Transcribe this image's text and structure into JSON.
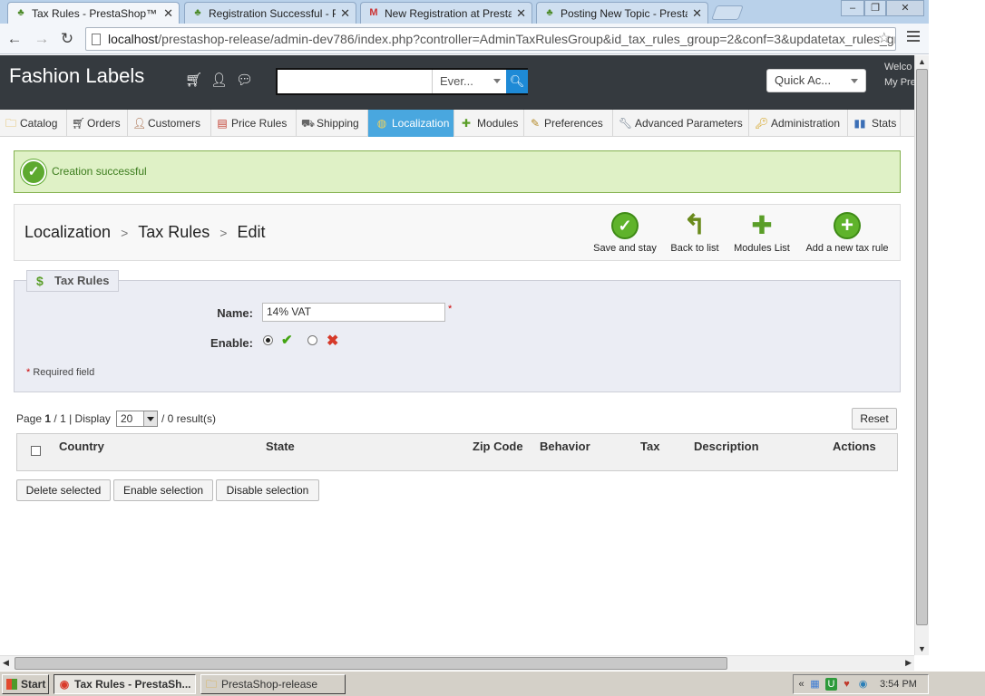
{
  "browser": {
    "tabs": [
      {
        "title": "Tax Rules - PrestaShop™",
        "active": true,
        "icon": "prestashop-favicon"
      },
      {
        "title": "Registration Successful - Pre",
        "active": false,
        "icon": "prestashop-favicon"
      },
      {
        "title": "New Registration at PrestaSh",
        "active": false,
        "icon": "gmail-favicon"
      },
      {
        "title": "Posting New Topic - PrestaSh",
        "active": false,
        "icon": "prestashop-favicon"
      }
    ],
    "url_host": "localhost",
    "url_path": "/prestashop-release/admin-dev786/index.php?controller=AdminTaxRulesGroup&id_tax_rules_group=2&conf=3&updatetax_rules_group"
  },
  "header": {
    "shop_name": "Fashion Labels",
    "search_placeholder": "",
    "search_scope": "Ever...",
    "quick_access": "Quick Ac...",
    "welcome_line1": "Welco",
    "welcome_line2": "My Pre"
  },
  "menu": [
    {
      "label": "Catalog",
      "icon": "folder-icon"
    },
    {
      "label": "Orders",
      "icon": "cart-icon"
    },
    {
      "label": "Customers",
      "icon": "user-icon"
    },
    {
      "label": "Price Rules",
      "icon": "price-rules-icon"
    },
    {
      "label": "Shipping",
      "icon": "truck-icon"
    },
    {
      "label": "Localization",
      "icon": "globe-icon",
      "active": true
    },
    {
      "label": "Modules",
      "icon": "puzzle-icon"
    },
    {
      "label": "Preferences",
      "icon": "preferences-icon"
    },
    {
      "label": "Advanced Parameters",
      "icon": "wrench-icon"
    },
    {
      "label": "Administration",
      "icon": "key-icon"
    },
    {
      "label": "Stats",
      "icon": "bar-chart-icon"
    }
  ],
  "alert": {
    "message": "Creation successful"
  },
  "breadcrumb": {
    "level1": "Localization",
    "level2": "Tax Rules",
    "level3": "Edit"
  },
  "toolbar_buttons": {
    "save_and_stay": "Save and stay",
    "back_to_list": "Back to list",
    "modules_list": "Modules List",
    "add_new_tax_rule": "Add a new tax rule"
  },
  "form": {
    "legend": "Tax Rules",
    "name_label": "Name:",
    "name_value": "14% VAT",
    "enable_label": "Enable:",
    "enabled": true,
    "required_note": "Required field",
    "required_mark": "*"
  },
  "list": {
    "page_prefix": "Page",
    "page_current": "1",
    "page_total_text": "/ 1 | Display",
    "display_value": "20",
    "result_text": "/ 0 result(s)",
    "reset_label": "Reset",
    "columns": [
      "Country",
      "State",
      "Zip Code",
      "Behavior",
      "Tax",
      "Description",
      "Actions"
    ],
    "delete_selected": "Delete selected",
    "enable_selection": "Enable selection",
    "disable_selection": "Disable selection"
  },
  "taskbar": {
    "start": "Start",
    "tasks": [
      "Tax Rules - PrestaSh...",
      "PrestaShop-release"
    ],
    "clock": "3:54 PM"
  },
  "colors": {
    "header_bg": "#353a3f",
    "active_menu": "#49a7df",
    "success_bg": "#dff1c6",
    "success_text": "#3d7d1e",
    "green_icon": "#5fb32b"
  }
}
